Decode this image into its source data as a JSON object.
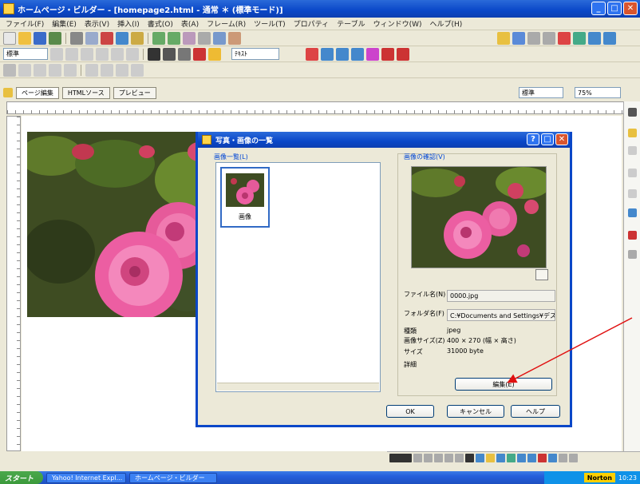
{
  "app": {
    "title": "ホームページ・ビルダー - [homepage2.html - 通常 ＊ (標準モード)]",
    "colors": {
      "accent": "#0a47c8",
      "arrow": "#e01010"
    }
  },
  "menu": [
    "ファイル(F)",
    "編集(E)",
    "表示(V)",
    "挿入(I)",
    "書式(O)",
    "表(A)",
    "フレーム(R)",
    "ツール(T)",
    "プロパティ",
    "テーブル",
    "ウィンドウ(W)",
    "ヘルプ(H)"
  ],
  "style_combo": "標準",
  "font_combo": "ﾃｷｽﾄ",
  "tabs": [
    "ページ編集",
    "HTMLソース",
    "プレビュー"
  ],
  "view_combo_1": "標準",
  "view_combo_2": "75%",
  "dialog": {
    "title": "写真・画像の一覧",
    "list_label": "画像一覧(L)",
    "thumbnail_name": "画像",
    "preview_label": "画像の確認(V)",
    "info": {
      "filename_label": "ファイル名(N)",
      "filename": "0000.jpg",
      "folder_label": "フォルダ名(F)",
      "folder": "C:¥Documents and Settings¥デスクトップ",
      "type_label": "種類",
      "type": "jpeg",
      "dimensions_label": "画像サイズ(Z)",
      "dimensions": "400 × 270 (幅 × 高さ)",
      "size_label": "サイズ",
      "size": "31000 byte",
      "detail_label": "詳細"
    },
    "edit_button": "編集(E)",
    "ok_button": "OK",
    "cancel_button": "キャンセル",
    "help_button": "ヘルプ"
  },
  "taskbar": {
    "start": "スタート",
    "items": [
      "Yahoo! Internet Expl...",
      "ホームページ・ビルダー"
    ],
    "norton": "Norton",
    "clock": "10:23"
  }
}
